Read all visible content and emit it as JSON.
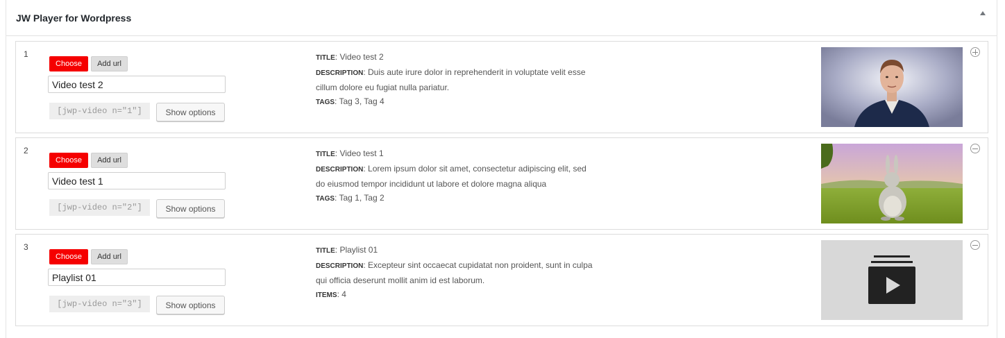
{
  "panel": {
    "title": "JW Player for Wordpress",
    "collapse_icon": "triangle-up-icon"
  },
  "labels": {
    "choose": "Choose",
    "add_url": "Add url",
    "show_options": "Show options",
    "title": "TITLE",
    "description": "DESCRIPTION",
    "tags": "TAGS",
    "items": "ITEMS",
    "sep": ": "
  },
  "colors": {
    "choose_button": "#f50000",
    "thumbnail_placeholder": "#d8d8d8"
  },
  "items": [
    {
      "index": "1",
      "input_value": "Video test 2",
      "shortcode": "[jwp-video n=\"1\"]",
      "meta_title": "Video test 2",
      "description": "Duis aute irure dolor in reprehenderit in voluptate velit esse cillum dolore eu fugiat nulla pariatur.",
      "third_label": "TAGS",
      "third_value": "Tag 3, Tag 4",
      "thumbnail": "presenter-video-thumbnail",
      "action_icon": "plus-circle-icon"
    },
    {
      "index": "2",
      "input_value": "Video test 1",
      "shortcode": "[jwp-video n=\"2\"]",
      "meta_title": "Video test 1",
      "description": "Lorem ipsum dolor sit amet, consectetur adipiscing elit, sed do eiusmod tempor incididunt ut labore et dolore magna aliqua",
      "third_label": "TAGS",
      "third_value": "Tag 1, Tag 2",
      "thumbnail": "cartoon-rabbit-video-thumbnail",
      "action_icon": "minus-circle-icon"
    },
    {
      "index": "3",
      "input_value": "Playlist 01",
      "shortcode": "[jwp-video n=\"3\"]",
      "meta_title": "Playlist 01",
      "description": "Excepteur sint occaecat cupidatat non proident, sunt in culpa qui officia deserunt mollit anim id est laborum.",
      "third_label": "ITEMS",
      "third_value": "4",
      "thumbnail": "playlist-icon",
      "action_icon": "minus-circle-icon"
    }
  ]
}
